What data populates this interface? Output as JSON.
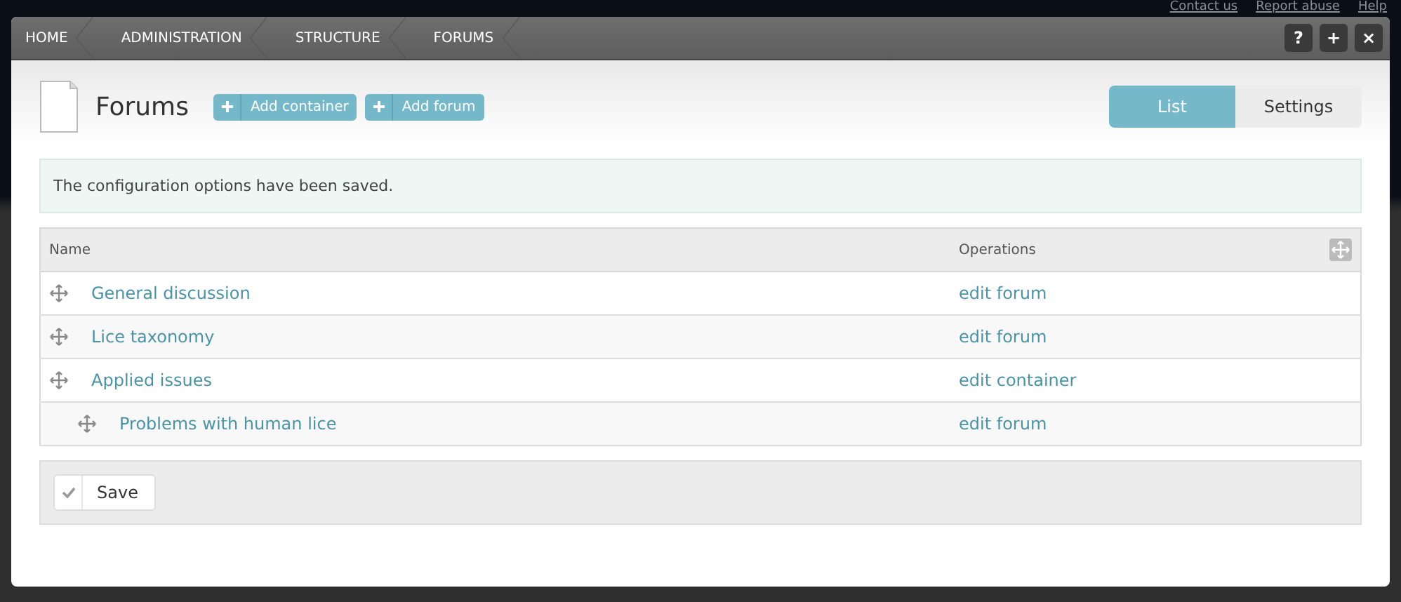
{
  "top_links": [
    "Contact us",
    "Report abuse",
    "Help"
  ],
  "breadcrumb": [
    "HOME",
    "ADMINISTRATION",
    "STRUCTURE",
    "FORUMS"
  ],
  "window_buttons": [
    "?",
    "+",
    "×"
  ],
  "page": {
    "title": "Forums",
    "actions": [
      "Add container",
      "Add forum"
    ]
  },
  "tabs": [
    {
      "label": "List",
      "selected": true
    },
    {
      "label": "Settings",
      "selected": false
    }
  ],
  "message": "The configuration options have been saved.",
  "table": {
    "columns": [
      "Name",
      "Operations"
    ],
    "rows": [
      {
        "name": "General discussion",
        "operation": "edit forum"
      },
      {
        "name": "Lice taxonomy",
        "operation": "edit forum"
      },
      {
        "name": "Applied issues",
        "operation": "edit container",
        "children": [
          {
            "name": "Problems with human lice",
            "operation": "edit forum"
          }
        ]
      }
    ]
  },
  "save_button": "Save"
}
